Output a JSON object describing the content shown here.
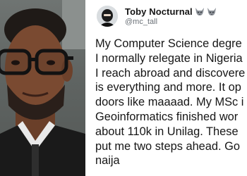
{
  "photo": {
    "subject_icon": "man-with-glasses-photo"
  },
  "tweet": {
    "author": {
      "display_name": "Toby Nocturnal",
      "handle": "@mc_tall",
      "name_badges": [
        "wolf-icon",
        "wolf-icon"
      ],
      "avatar_icon": "masked-person-avatar"
    },
    "lines": [
      "My Computer Science degre",
      "I normally relegate in Nigeria",
      "I reach abroad and discovere",
      "is everything and more. It op",
      "doors like maaaad. My MSc i",
      "Geoinformatics finished wor",
      "about 110k in Unilag. These",
      "put me two steps ahead. Go",
      "naija"
    ]
  },
  "colors": {
    "name": "#141414",
    "handle": "#6b7177",
    "text": "#161616",
    "background": "#ffffff"
  }
}
